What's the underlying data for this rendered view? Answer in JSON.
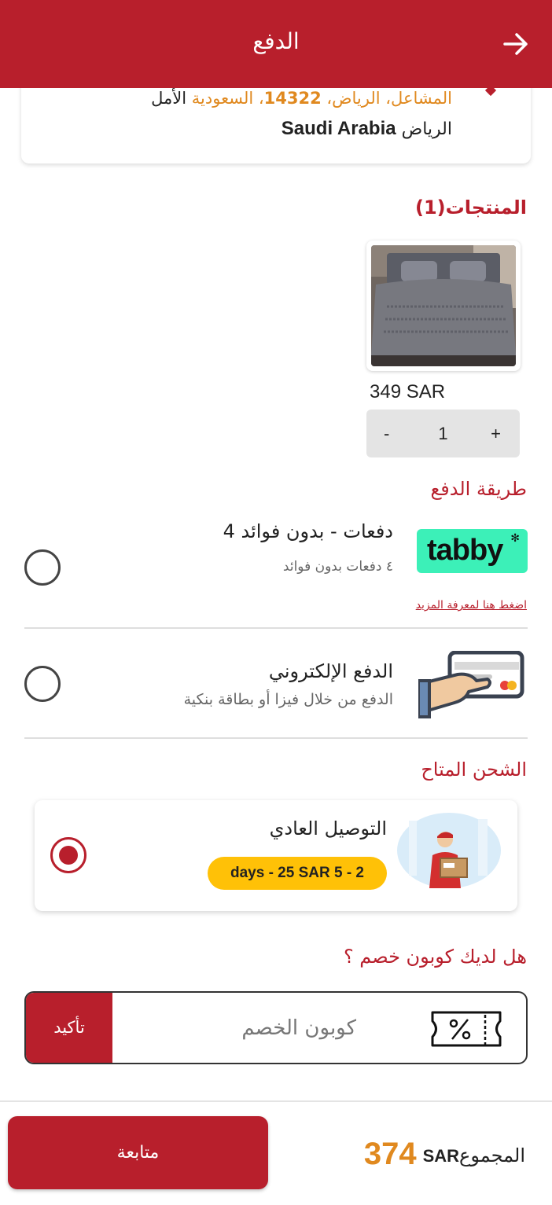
{
  "header": {
    "title": "الدفع",
    "back_icon": "arrow-right-icon"
  },
  "address": {
    "district": "المشاعل، الرياض، ",
    "postal": "14322",
    "country_ar": "، السعودية ",
    "hope": "الأمل",
    "city": "الرياض",
    "country_en": "Saudi Arabia"
  },
  "products": {
    "title": "المنتجات(1)",
    "items": [
      {
        "price": "349 SAR",
        "minus": "-",
        "quantity": "1",
        "plus": "+"
      }
    ]
  },
  "payment": {
    "title": "طريقة الدفع",
    "tabby": {
      "logo_text": "tabby",
      "logo_star": "✻",
      "title": "دفعات - بدون فوائد 4",
      "subtitle": "٤ دفعات بدون فوائد",
      "link": "اضغط هنا لمعرفة المزيد"
    },
    "card": {
      "title": "الدفع الإلكتروني",
      "subtitle": "الدفع من خلال فيزا أو بطاقة بنكية"
    }
  },
  "shipping": {
    "title": "الشحن المتاح",
    "option": {
      "name": "التوصيل العادي",
      "badge": "days - 25 SAR 5 - 2",
      "selected": true
    }
  },
  "coupon": {
    "question": "هل لديك كوبون خصم ؟",
    "placeholder": "كوبون الخصم",
    "confirm": "تأكيد"
  },
  "footer": {
    "continue": "متابعة",
    "total_label": "المجموع",
    "total_amount": "374",
    "currency": "SAR"
  },
  "colors": {
    "primary": "#b81f2c",
    "accent": "#e0891f",
    "tabby": "#3cf0b8",
    "badge": "#ffc107"
  }
}
